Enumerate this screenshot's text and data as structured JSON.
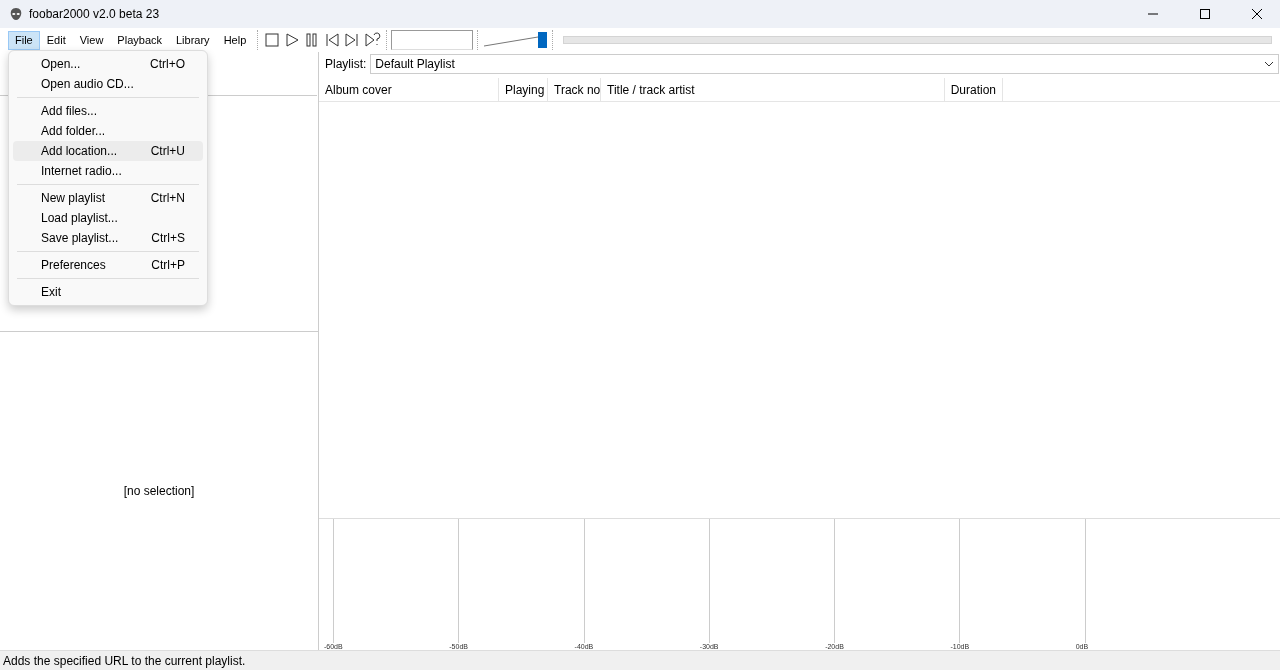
{
  "window": {
    "title": "foobar2000 v2.0 beta 23"
  },
  "menu_bar": [
    {
      "label": "File",
      "selected": true
    },
    {
      "label": "Edit",
      "selected": false
    },
    {
      "label": "View",
      "selected": false
    },
    {
      "label": "Playback",
      "selected": false
    },
    {
      "label": "Library",
      "selected": false
    },
    {
      "label": "Help",
      "selected": false
    }
  ],
  "volume": {
    "level": 1
  },
  "file_menu": [
    {
      "kind": "item",
      "label": "Open...",
      "shortcut": "Ctrl+O",
      "selected": false
    },
    {
      "kind": "item",
      "label": "Open audio CD...",
      "selected": false
    },
    {
      "kind": "separator"
    },
    {
      "kind": "item",
      "label": "Add files...",
      "selected": false
    },
    {
      "kind": "item",
      "label": "Add folder...",
      "selected": false
    },
    {
      "kind": "item",
      "label": "Add location...",
      "shortcut": "Ctrl+U",
      "selected": true
    },
    {
      "kind": "item",
      "label": "Internet radio...",
      "selected": false
    },
    {
      "kind": "separator"
    },
    {
      "kind": "item",
      "label": "New playlist",
      "shortcut": "Ctrl+N",
      "selected": false
    },
    {
      "kind": "item",
      "label": "Load playlist...",
      "selected": false
    },
    {
      "kind": "item",
      "label": "Save playlist...",
      "shortcut": "Ctrl+S",
      "selected": false
    },
    {
      "kind": "separator"
    },
    {
      "kind": "item",
      "label": "Preferences",
      "shortcut": "Ctrl+P",
      "selected": false
    },
    {
      "kind": "separator"
    },
    {
      "kind": "item",
      "label": "Exit",
      "selected": false
    }
  ],
  "selection_panel": {
    "text": "[no selection]"
  },
  "playlist": {
    "label": "Playlist:",
    "value": "Default Playlist",
    "columns": [
      "Album cover",
      "Playing",
      "Track no",
      "Title / track artist",
      "Duration"
    ]
  },
  "peak_meter": {
    "ticks": [
      "-60dB",
      "-50dB",
      "-40dB",
      "-30dB",
      "-20dB",
      "-10dB",
      "0dB"
    ]
  },
  "status_bar": "Adds the specified URL to the current playlist."
}
